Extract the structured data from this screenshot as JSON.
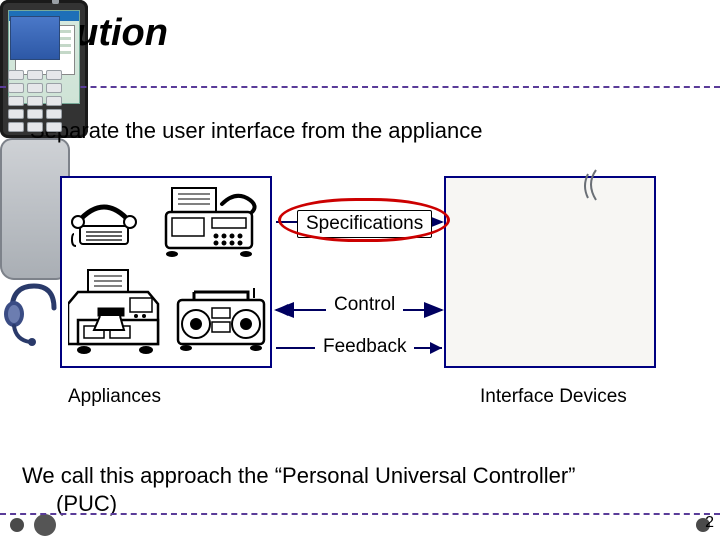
{
  "title": "Solution",
  "subtitle": "Separate the user interface from the appliance",
  "diagram": {
    "left_caption": "Appliances",
    "right_caption": "Interface Devices",
    "arrows": {
      "specifications": "Specifications",
      "control": "Control",
      "feedback": "Feedback"
    }
  },
  "conclusion": {
    "line1": "We call this approach the “Personal Universal Controller”",
    "line2": "(PUC)"
  },
  "page_number": "2",
  "colors": {
    "accent_purple": "#5a3c99",
    "box_navy": "#000080",
    "highlight_red": "#cc0000",
    "arrow": "#000060"
  }
}
